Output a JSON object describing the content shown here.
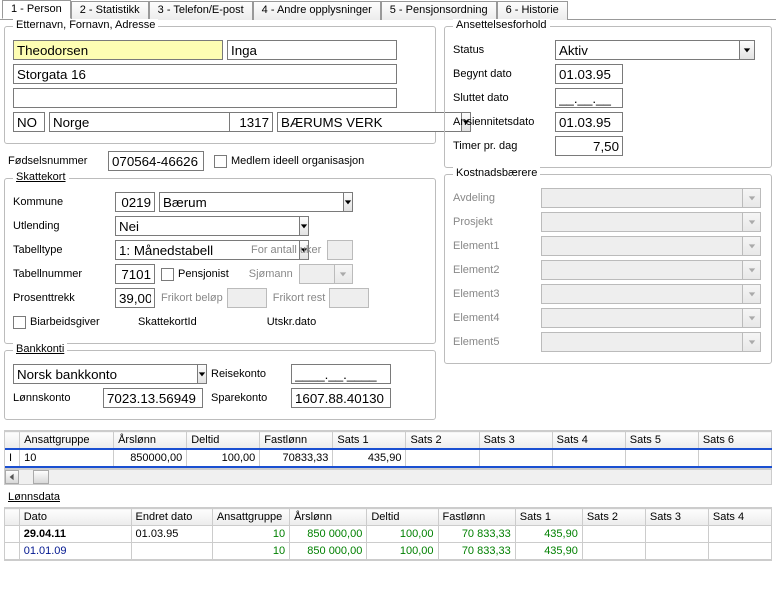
{
  "tabs": [
    "1 - Person",
    "2 - Statistikk",
    "3 - Telefon/E-post",
    "4 - Andre opplysninger",
    "5 - Pensjonsordning",
    "6 - Historie"
  ],
  "ident": {
    "title": "Etternavn, Fornavn, Adresse",
    "last": "Theodorsen",
    "first": "Inga",
    "addr1": "Storgata 16",
    "addr2": "",
    "country_code": "NO",
    "country": "Norge",
    "postcode": "1317",
    "city": "BÆRUMS VERK",
    "fnr_label": "Fødselsnummer",
    "fnr": "070564-46626",
    "medlem_label": "Medlem ideell organisasjon"
  },
  "ans": {
    "title": "Ansettelsesforhold",
    "status_label": "Status",
    "status": "Aktiv",
    "begynt_label": "Begynt dato",
    "begynt": "01.03.95",
    "sluttet_label": "Sluttet dato",
    "sluttet": "__.__.__",
    "ansiennitet_label": "Ansiennitetsdato",
    "ansiennitet": "01.03.95",
    "timer_label": "Timer pr. dag",
    "timer": "7,50"
  },
  "skatt": {
    "title": "Skattekort",
    "kommune_label": "Kommune",
    "kommune_code": "0219",
    "kommune": "Bærum",
    "utlending_label": "Utlending",
    "utlending": "Nei",
    "tabelltype_label": "Tabelltype",
    "tabelltype": "1: Månedstabell",
    "forantall_label": "For antall uker",
    "tabellnr_label": "Tabellnummer",
    "tabellnr": "7101",
    "pensjonist_label": "Pensjonist",
    "sjomann_label": "Sjømann",
    "prosent_label": "Prosenttrekk",
    "prosent": "39,00",
    "frikortb_label": "Frikort beløp",
    "frikortr_label": "Frikort rest",
    "biarb_label": "Biarbeidsgiver",
    "skid_label": "SkattekortId",
    "utskr_label": "Utskr.dato"
  },
  "kost": {
    "title": "Kostnadsbærere",
    "labels": [
      "Avdeling",
      "Prosjekt",
      "Element1",
      "Element2",
      "Element3",
      "Element4",
      "Element5"
    ]
  },
  "bank": {
    "title": "Bankkonti",
    "type": "Norsk bankkonto",
    "lonnsk_label": "Lønnskonto",
    "lonnsk": "7023.13.56949",
    "reisek_label": "Reisekonto",
    "reisek": "____.__.____",
    "sparek_label": "Sparekonto",
    "sparek": "1607.88.40130"
  },
  "grid1": {
    "headers": [
      "Ansattgruppe",
      "Årslønn",
      "Deltid",
      "Fastlønn",
      "Sats 1",
      "Sats 2",
      "Sats 3",
      "Sats 4",
      "Sats 5",
      "Sats 6"
    ],
    "row": [
      "10",
      "850000,00",
      "100,00",
      "70833,33",
      "435,90",
      "",
      "",
      "",
      "",
      ""
    ]
  },
  "lonnsdata_label": "Lønnsdata",
  "grid2": {
    "headers": [
      "Dato",
      "Endret dato",
      "Ansattgruppe",
      "Årslønn",
      "Deltid",
      "Fastlønn",
      "Sats 1",
      "Sats 2",
      "Sats 3",
      "Sats 4"
    ],
    "rows": [
      [
        "29.04.11",
        "01.03.95",
        "10",
        "850 000,00",
        "100,00",
        "70 833,33",
        "435,90",
        "",
        "",
        ""
      ],
      [
        "01.01.09",
        "",
        "10",
        "850 000,00",
        "100,00",
        "70 833,33",
        "435,90",
        "",
        "",
        ""
      ]
    ]
  }
}
